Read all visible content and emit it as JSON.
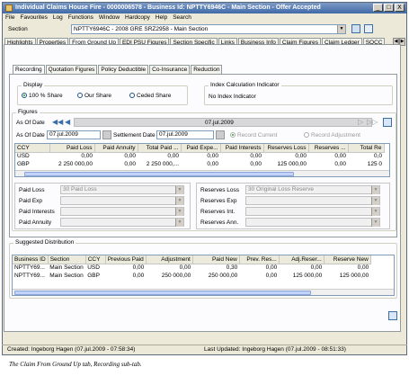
{
  "window": {
    "title": "Individual Claims House Fire - 0000006578 - Business Id: NPTTY6946C - Main Section - Offer Accepted",
    "controls": [
      "_",
      "□",
      "X"
    ]
  },
  "menu": [
    "File",
    "Favourites",
    "Log",
    "Functions",
    "Window",
    "Hardcopy",
    "Help",
    "Search"
  ],
  "section": {
    "label": "Section",
    "value": "NPTTY6946C - 2008 GRE SRZ2958 - Main Section"
  },
  "main_tabs": [
    "Highlights",
    "Properties",
    "From Ground Up",
    "EDI PSU Figures",
    "Section Specific",
    "Links",
    "Business Info",
    "Claim Figures",
    "Claim Ledger",
    "SOCC"
  ],
  "main_tabs_active": 2,
  "sub_tabs": [
    "Recording",
    "Quotation Figures",
    "Policy Deductible",
    "Co-Insurance",
    "Reduction"
  ],
  "display": {
    "legend": "Display",
    "options": [
      "100 % Share",
      "Our Share",
      "Ceded Share"
    ],
    "selected": 0
  },
  "index": {
    "legend": "Index Calculation Indicator",
    "value": "No Index Indicator"
  },
  "figures": {
    "legend": "Figures",
    "as_of_date_label": "As Of Date",
    "band_date": "07.jul.2009",
    "as_of_label": "As Of Date",
    "as_of_value": "07.jul.2009",
    "settlement_label": "Settlement Date",
    "settlement_value": "07.jul.2009",
    "record_current": "Record Current",
    "record_adjustment": "Record Adjustment",
    "columns": [
      "CCY",
      "Paid Loss",
      "Paid Annuity",
      "Total Paid ...",
      "Paid Expe...",
      "Paid Interests",
      "Reserves Loss",
      "Reserves ...",
      "Total Re"
    ],
    "rows": [
      [
        "USD",
        "0,00",
        "0,00",
        "0,00",
        "0,00",
        "0,00",
        "0,00",
        "0,00",
        "0,0"
      ],
      [
        "GBP",
        "2 250 000,00",
        "0,00",
        "2 250 000,...",
        "0,00",
        "0,00",
        "125 000,00",
        "0,00",
        "125 0"
      ]
    ]
  },
  "left_fields": [
    {
      "label": "Paid Loss",
      "value": "30 Paid Loss"
    },
    {
      "label": "Paid Exp",
      "value": ""
    },
    {
      "label": "Paid Interests",
      "value": ""
    },
    {
      "label": "Paid Annuity",
      "value": ""
    }
  ],
  "right_fields": [
    {
      "label": "Reserves Loss",
      "value": "30 Original Loss Reserve"
    },
    {
      "label": "Reserves Exp",
      "value": ""
    },
    {
      "label": "Reserves Int.",
      "value": ""
    },
    {
      "label": "Reserves Ann.",
      "value": ""
    }
  ],
  "suggested": {
    "legend": "Suggested Distribution",
    "columns": [
      "Business ID",
      "Section",
      "CCY",
      "Previous Paid",
      "Adjustment",
      "Paid New",
      "Prev. Res...",
      "Adj.Reser...",
      "Reserve New"
    ],
    "rows": [
      [
        "NPTTY69...",
        "Main Section",
        "USD",
        "0,00",
        "0,00",
        "0,30",
        "0,00",
        "0,00",
        "0,00"
      ],
      [
        "NPTTY69...",
        "Main Section",
        "GBP",
        "0,00",
        "250 000,00",
        "250 000,00",
        "0,00",
        "125 000,00",
        "125 000,00"
      ]
    ]
  },
  "status": {
    "created": "Created: Ingeborg Hagen (07.jul.2009 - 07:58:34)",
    "updated": "Last Updated: Ingeborg Hagen (07.jul.2009 - 08:51:33)"
  },
  "caption": "The Claim From Ground Up tab, Recording sub-tab.",
  "colors": {
    "title_start": "#7e9ac4",
    "title_end": "#3f6aa8",
    "accent": "#3a6ea5"
  },
  "icons": [
    "app-icon",
    "rewind-icon",
    "back-icon",
    "forward-icon",
    "fast-forward-icon",
    "calendar-icon",
    "refresh-icon",
    "print-icon"
  ]
}
